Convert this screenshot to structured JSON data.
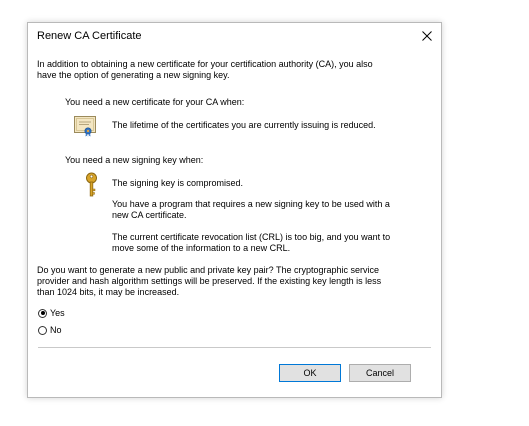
{
  "dialog": {
    "title": "Renew CA Certificate",
    "intro_line1": "In addition to obtaining a new certificate for your certification authority (CA), you also",
    "intro_line2": "have the option of generating a new signing key.",
    "cert_heading": "You need a new certificate for your CA when:",
    "cert_reason": "The lifetime of the certificates you are currently issuing is reduced.",
    "key_heading": "You need a new signing key when:",
    "key_reasons": [
      {
        "line1": "The signing key is compromised.",
        "line2": ""
      },
      {
        "line1": "You have a program that requires a new signing key to be used with a",
        "line2": "new CA certificate."
      },
      {
        "line1": "The current certificate revocation list (CRL) is too big, and you want to",
        "line2": "move some of the information to a new CRL."
      }
    ],
    "question_line1": "Do you want to generate a new public and private key pair? The cryptographic service",
    "question_line2": "provider and hash algorithm settings will be preserved.  If the existing key length is less",
    "question_line3": "than 1024 bits, it may be increased.",
    "options": [
      {
        "label": "Yes",
        "selected": true
      },
      {
        "label": "No",
        "selected": false
      }
    ],
    "ok_label": "OK",
    "cancel_label": "Cancel",
    "icons": {
      "close": "close-icon",
      "certificate": "certificate-icon",
      "key": "key-icon"
    },
    "colors": {
      "accent": "#0078d7",
      "key_gold": "#d9a52a",
      "cert_beige": "#f3e6c2"
    }
  }
}
